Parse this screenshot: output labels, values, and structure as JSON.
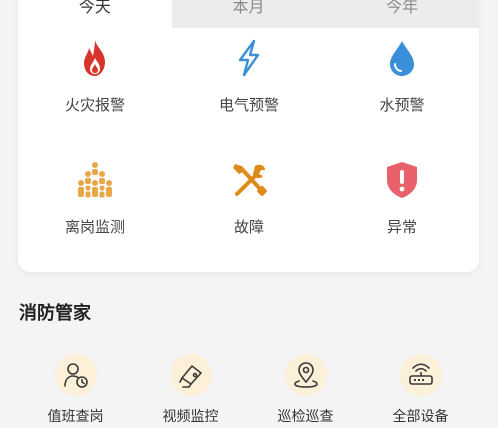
{
  "tabs": [
    {
      "label": "今天",
      "active": true
    },
    {
      "label": "本月",
      "active": false
    },
    {
      "label": "今年",
      "active": false
    }
  ],
  "alerts": [
    {
      "label": "火灾报警",
      "icon": "fire-icon",
      "color": "#d9342b"
    },
    {
      "label": "电气预警",
      "icon": "lightning-icon",
      "color": "#3a8fd9"
    },
    {
      "label": "水预警",
      "icon": "water-drop-icon",
      "color": "#3a8fd9"
    },
    {
      "label": "离岗监测",
      "icon": "people-group-icon",
      "color": "#e8a84a"
    },
    {
      "label": "故障",
      "icon": "tools-icon",
      "color": "#e08a1a"
    },
    {
      "label": "异常",
      "icon": "shield-alert-icon",
      "color": "#e8606a"
    }
  ],
  "section_title": "消防管家",
  "steward": [
    {
      "label": "值班查岗",
      "icon": "user-clock-icon"
    },
    {
      "label": "视频监控",
      "icon": "camera-icon"
    },
    {
      "label": "巡检巡查",
      "icon": "location-pin-icon"
    },
    {
      "label": "全部设备",
      "icon": "router-icon"
    }
  ],
  "colors": {
    "steward_icon_bg": "#fdf0d8",
    "steward_icon_stroke": "#3a3a3a"
  }
}
